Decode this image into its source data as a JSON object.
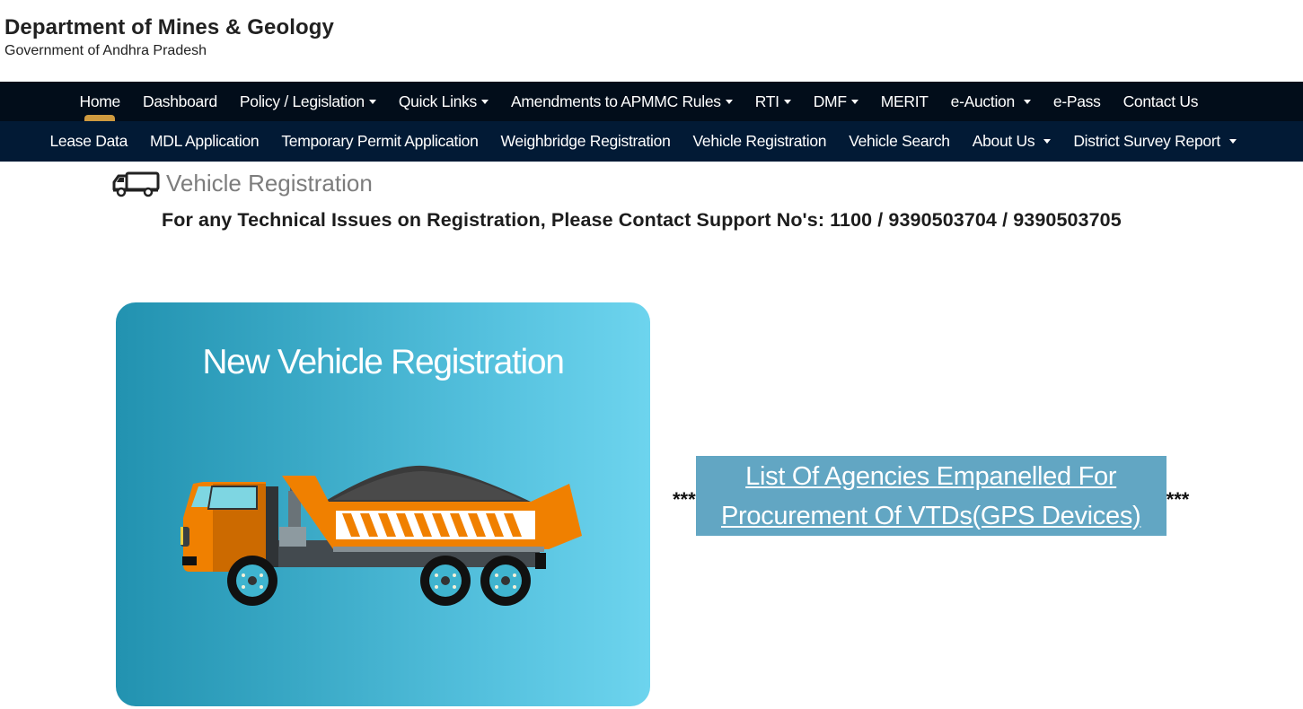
{
  "header": {
    "title": "Department of Mines & Geology",
    "subtitle": "Government of Andhra Pradesh"
  },
  "nav_primary": {
    "active": "Home",
    "items": [
      {
        "label": "Home",
        "dropdown": false
      },
      {
        "label": "Dashboard",
        "dropdown": false
      },
      {
        "label": "Policy / Legislation",
        "dropdown": true
      },
      {
        "label": "Quick Links",
        "dropdown": true
      },
      {
        "label": "Amendments to APMMC Rules",
        "dropdown": true
      },
      {
        "label": "RTI",
        "dropdown": true
      },
      {
        "label": "DMF",
        "dropdown": true
      },
      {
        "label": "MERIT",
        "dropdown": false
      },
      {
        "label": "e-Auction",
        "dropdown": true
      },
      {
        "label": "e-Pass",
        "dropdown": false
      },
      {
        "label": "Contact Us",
        "dropdown": false
      }
    ]
  },
  "nav_secondary": {
    "items": [
      {
        "label": "Lease Data",
        "dropdown": false
      },
      {
        "label": "MDL Application",
        "dropdown": false
      },
      {
        "label": "Temporary Permit Application",
        "dropdown": false
      },
      {
        "label": "Weighbridge Registration",
        "dropdown": false
      },
      {
        "label": "Vehicle Registration",
        "dropdown": false
      },
      {
        "label": "Vehicle Search",
        "dropdown": false
      },
      {
        "label": "About Us",
        "dropdown": true
      },
      {
        "label": "District Survey Report",
        "dropdown": true
      }
    ]
  },
  "page": {
    "heading": "Vehicle Registration",
    "heading_icon": "truck-icon",
    "support_text": "For any Technical Issues on Registration, Please Contact Support No's: 1100 / 9390503704 / 9390503705"
  },
  "card": {
    "title": "New Vehicle Registration",
    "image": "dump-truck-illustration"
  },
  "agencies_link": {
    "prefix": "***",
    "line1": "List Of Agencies Empanelled For",
    "line2": "Procurement Of VTDs(GPS Devices)",
    "suffix": "***"
  },
  "colors": {
    "nav_primary_bg": "#020d1a",
    "nav_secondary_bg": "#021a35",
    "active_indicator": "#cf9a3f",
    "card_gradient_start": "#2292b0",
    "card_gradient_end": "#6dd4ee",
    "agency_box_bg": "#62a6c3",
    "truck_orange": "#f08000"
  }
}
